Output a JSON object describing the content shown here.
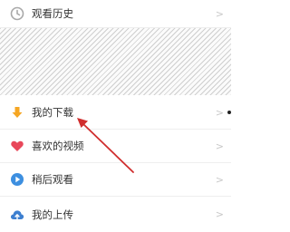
{
  "menu": {
    "items": [
      {
        "label": "观看历史",
        "icon": "clock-history-icon",
        "color": "#a9a9a9"
      },
      {
        "label": "我的下载",
        "icon": "download-arrow-icon",
        "color": "#f5a623"
      },
      {
        "label": "喜欢的视频",
        "icon": "heart-icon",
        "color": "#e8475a"
      },
      {
        "label": "稍后观看",
        "icon": "play-circle-icon",
        "color": "#3d8fe0"
      },
      {
        "label": "我的上传",
        "icon": "cloud-upload-icon",
        "color": "#3d7fd0"
      }
    ],
    "chevron": ">"
  },
  "annotation": {
    "arrow_color": "#d02e2e"
  }
}
